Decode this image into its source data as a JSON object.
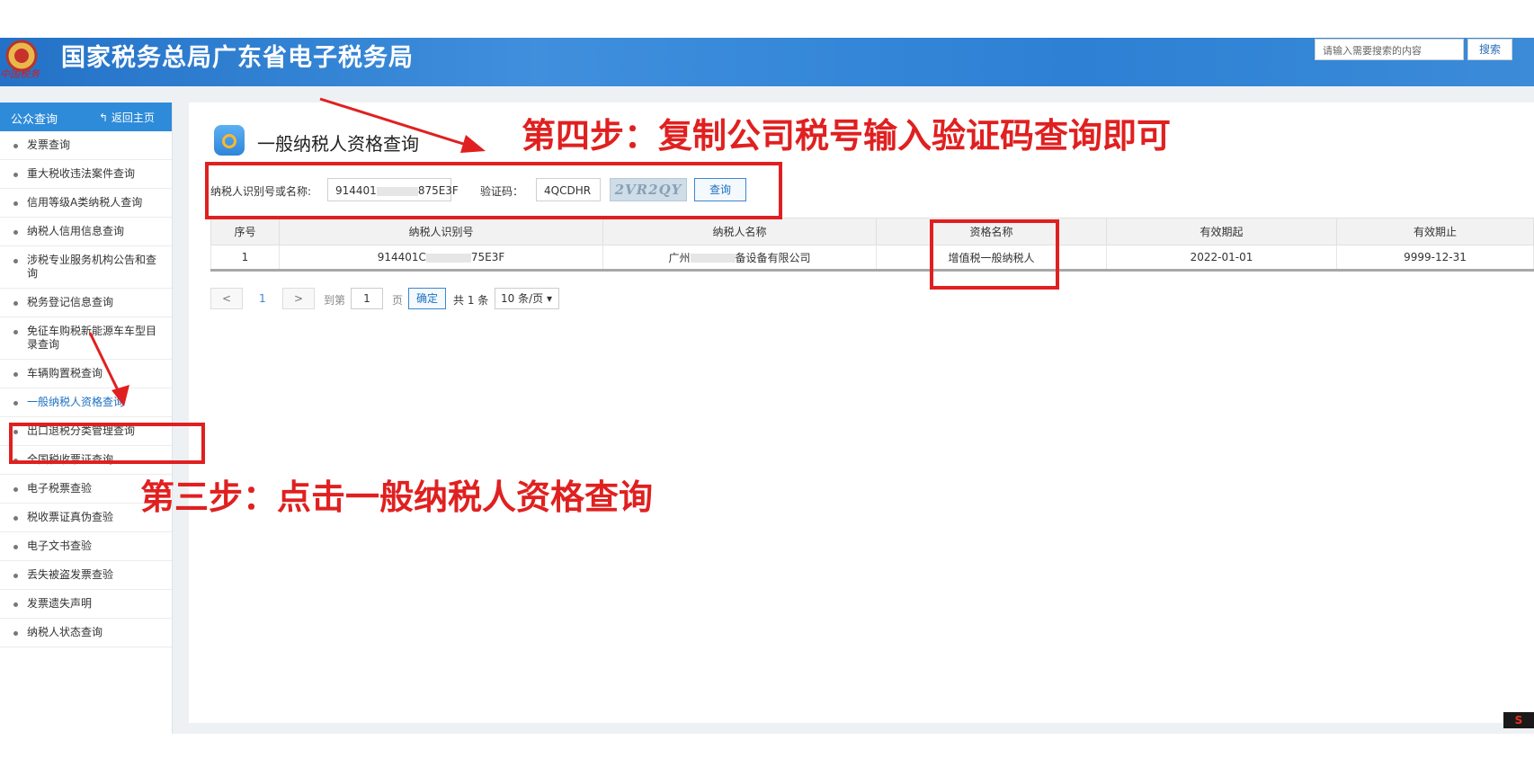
{
  "header": {
    "site_title": "国家税务总局广东省电子税务局",
    "emblem_text": "中国税务",
    "search_placeholder": "请输入需要搜索的内容",
    "search_button": "搜索"
  },
  "sidebar": {
    "title": "公众查询",
    "back_label": "返回主页",
    "items": [
      "发票查询",
      "重大税收违法案件查询",
      "信用等级A类纳税人查询",
      "纳税人信用信息查询",
      "涉税专业服务机构公告和查询",
      "税务登记信息查询",
      "免征车购税新能源车车型目录查询",
      "车辆购置税查询",
      "一般纳税人资格查询",
      "出口退税分类管理查询",
      "全国税收票证查询",
      "电子税票查验",
      "税收票证真伪查验",
      "电子文书查验",
      "丢失被盗发票查验",
      "发票遗失声明",
      "纳税人状态查询"
    ]
  },
  "main": {
    "page_title": "一般纳税人资格查询",
    "form": {
      "taxpayer_label": "纳税人识别号或名称:",
      "taxpayer_value_start": "914401",
      "taxpayer_value_end": "875E3F",
      "captcha_label": "验证码：",
      "captcha_value": "4QCDHR",
      "captcha_image_text": "2VR2QY",
      "query_button": "查询"
    },
    "table": {
      "headers": [
        "序号",
        "纳税人识别号",
        "纳税人名称",
        "资格名称",
        "有效期起",
        "有效期止"
      ],
      "row": {
        "index": "1",
        "tax_id_start": "914401C",
        "tax_id_end": "75E3F",
        "name_start": "广州",
        "name_end": "备设备有限公司",
        "qualification": "增值税一般纳税人",
        "valid_from": "2022-01-01",
        "valid_to": "9999-12-31"
      }
    },
    "pager": {
      "prev": "<",
      "current": "1",
      "next": ">",
      "goto_label": "到第",
      "page_input": "1",
      "page_unit": "页",
      "confirm": "确定",
      "total": "共 1 条",
      "page_size": "10 条/页"
    }
  },
  "annotations": {
    "step3": "第三步：点击一般纳税人资格查询",
    "step4": "第四步：复制公司税号输入验证码查询即可",
    "color": "#e02020"
  },
  "corner_icon": "S"
}
